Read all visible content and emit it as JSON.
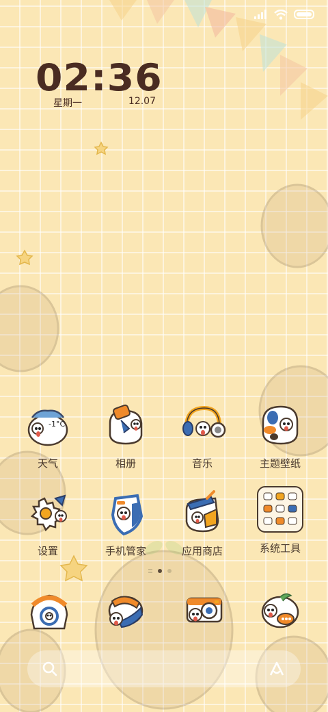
{
  "clock": {
    "time": "02:36",
    "weekday": "星期一",
    "date": "12.07"
  },
  "weather": {
    "temperature": "-1°C"
  },
  "apps": [
    {
      "label": "天气",
      "icon": "weather-icon"
    },
    {
      "label": "相册",
      "icon": "gallery-icon"
    },
    {
      "label": "音乐",
      "icon": "music-icon"
    },
    {
      "label": "主题壁纸",
      "icon": "themes-icon"
    },
    {
      "label": "设置",
      "icon": "settings-icon"
    },
    {
      "label": "手机管家",
      "icon": "security-icon"
    },
    {
      "label": "应用商店",
      "icon": "app-store-icon"
    },
    {
      "label": "系统工具",
      "icon": "system-tools-folder-icon"
    }
  ],
  "dock": [
    {
      "icon": "phone-icon"
    },
    {
      "icon": "messages-icon"
    },
    {
      "icon": "camera-icon"
    },
    {
      "icon": "chat-icon"
    }
  ],
  "page_indicator": {
    "pages": 2,
    "active": 1
  },
  "colors": {
    "background": "#fbe7b5",
    "grid": "#ffffff",
    "clock_text": "#4a2c22",
    "label_text": "#4a3a2e",
    "accent_orange": "#f08a2a",
    "accent_blue": "#3b6db3"
  }
}
